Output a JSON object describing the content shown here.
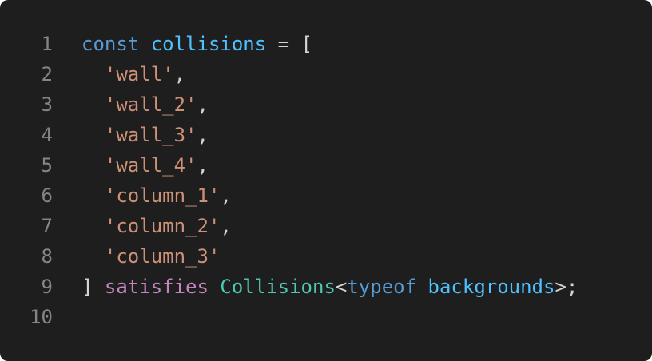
{
  "theme": {
    "background": "#1e1e1e",
    "line_number": "#858585",
    "keyword": "#569cd6",
    "variable": "#4fc1ff",
    "string": "#ce9178",
    "control_keyword": "#c586c0",
    "type": "#4ec9b0",
    "punctuation": "#d4d4d4"
  },
  "lines": [
    {
      "number": "1",
      "tokens": [
        {
          "text": "const",
          "cls": "kw"
        },
        {
          "text": " ",
          "cls": "op"
        },
        {
          "text": "collisions",
          "cls": "var"
        },
        {
          "text": " = ",
          "cls": "op"
        },
        {
          "text": "[",
          "cls": "punc"
        }
      ]
    },
    {
      "number": "2",
      "tokens": [
        {
          "text": "  ",
          "cls": "op"
        },
        {
          "text": "'wall'",
          "cls": "str"
        },
        {
          "text": ",",
          "cls": "punc"
        }
      ]
    },
    {
      "number": "3",
      "tokens": [
        {
          "text": "  ",
          "cls": "op"
        },
        {
          "text": "'wall_2'",
          "cls": "str"
        },
        {
          "text": ",",
          "cls": "punc"
        }
      ]
    },
    {
      "number": "4",
      "tokens": [
        {
          "text": "  ",
          "cls": "op"
        },
        {
          "text": "'wall_3'",
          "cls": "str"
        },
        {
          "text": ",",
          "cls": "punc"
        }
      ]
    },
    {
      "number": "5",
      "tokens": [
        {
          "text": "  ",
          "cls": "op"
        },
        {
          "text": "'wall_4'",
          "cls": "str"
        },
        {
          "text": ",",
          "cls": "punc"
        }
      ]
    },
    {
      "number": "6",
      "tokens": [
        {
          "text": "  ",
          "cls": "op"
        },
        {
          "text": "'column_1'",
          "cls": "str"
        },
        {
          "text": ",",
          "cls": "punc"
        }
      ]
    },
    {
      "number": "7",
      "tokens": [
        {
          "text": "  ",
          "cls": "op"
        },
        {
          "text": "'column_2'",
          "cls": "str"
        },
        {
          "text": ",",
          "cls": "punc"
        }
      ]
    },
    {
      "number": "8",
      "tokens": [
        {
          "text": "  ",
          "cls": "op"
        },
        {
          "text": "'column_3'",
          "cls": "str"
        }
      ]
    },
    {
      "number": "9",
      "tokens": [
        {
          "text": "]",
          "cls": "punc"
        },
        {
          "text": " ",
          "cls": "op"
        },
        {
          "text": "satisfies",
          "cls": "ctl"
        },
        {
          "text": " ",
          "cls": "op"
        },
        {
          "text": "Collisions",
          "cls": "type"
        },
        {
          "text": "<",
          "cls": "punc"
        },
        {
          "text": "typeof",
          "cls": "kw"
        },
        {
          "text": " ",
          "cls": "op"
        },
        {
          "text": "backgrounds",
          "cls": "var"
        },
        {
          "text": ">;",
          "cls": "punc"
        }
      ]
    },
    {
      "number": "10",
      "tokens": []
    }
  ]
}
